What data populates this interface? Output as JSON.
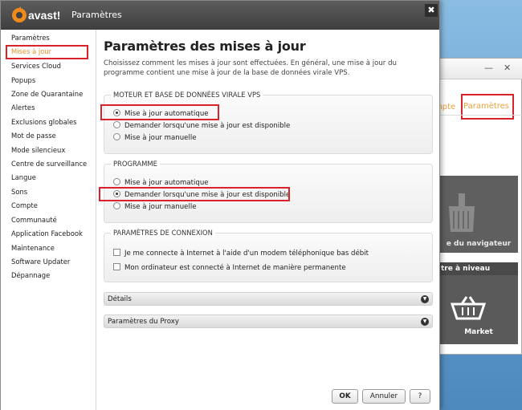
{
  "dialog": {
    "title": "Paramètres",
    "close_glyph": "✖",
    "accent_color": "#e6932d"
  },
  "sidebar": {
    "items": [
      "Paramètres",
      "Mises à jour",
      "Services Cloud",
      "Popups",
      "Zone de Quarantaine",
      "Alertes",
      "Exclusions globales",
      "Mot de passe",
      "Mode silencieux",
      "Centre de surveillance",
      "Langue",
      "Sons",
      "Compte",
      "Communauté",
      "Application Facebook",
      "Maintenance",
      "Software Updater",
      "Dépannage"
    ],
    "active_index": 1
  },
  "main": {
    "title": "Paramètres des mises à jour",
    "description": "Choisissez comment les mises à jour sont effectuées. En général, une mise à jour du programme contient une mise à jour de la base de données virale VPS.",
    "vps_group": {
      "title": "MOTEUR ET BASE DE DONNÉES VIRALE VPS",
      "options": [
        "Mise à jour automatique",
        "Demander lorsqu'une mise à jour est disponible",
        "Mise à jour manuelle"
      ],
      "selected_index": 0
    },
    "program_group": {
      "title": "PROGRAMME",
      "options": [
        "Mise à jour automatique",
        "Demander lorsqu'une mise à jour est disponible",
        "Mise à jour manuelle"
      ],
      "selected_index": 1
    },
    "connection_group": {
      "title": "PARAMÈTRES DE CONNEXION",
      "options": [
        "Je me connecte à Internet à l'aide d'un modem téléphonique bas débit",
        "Mon ordinateur est connecté à Internet de manière permanente"
      ],
      "checked": [
        false,
        false
      ]
    },
    "sections": [
      "Détails",
      "Paramètres du Proxy"
    ]
  },
  "buttons": {
    "ok": "OK",
    "cancel": "Annuler",
    "help": "?"
  },
  "background_window": {
    "tab_compte": "mpte",
    "tab_params": "Paramètres",
    "tile_browser": "e du navigateur",
    "band": "tre à niveau",
    "tile_market": "Market",
    "minimize_glyph": "—",
    "close_glyph": "✕"
  }
}
